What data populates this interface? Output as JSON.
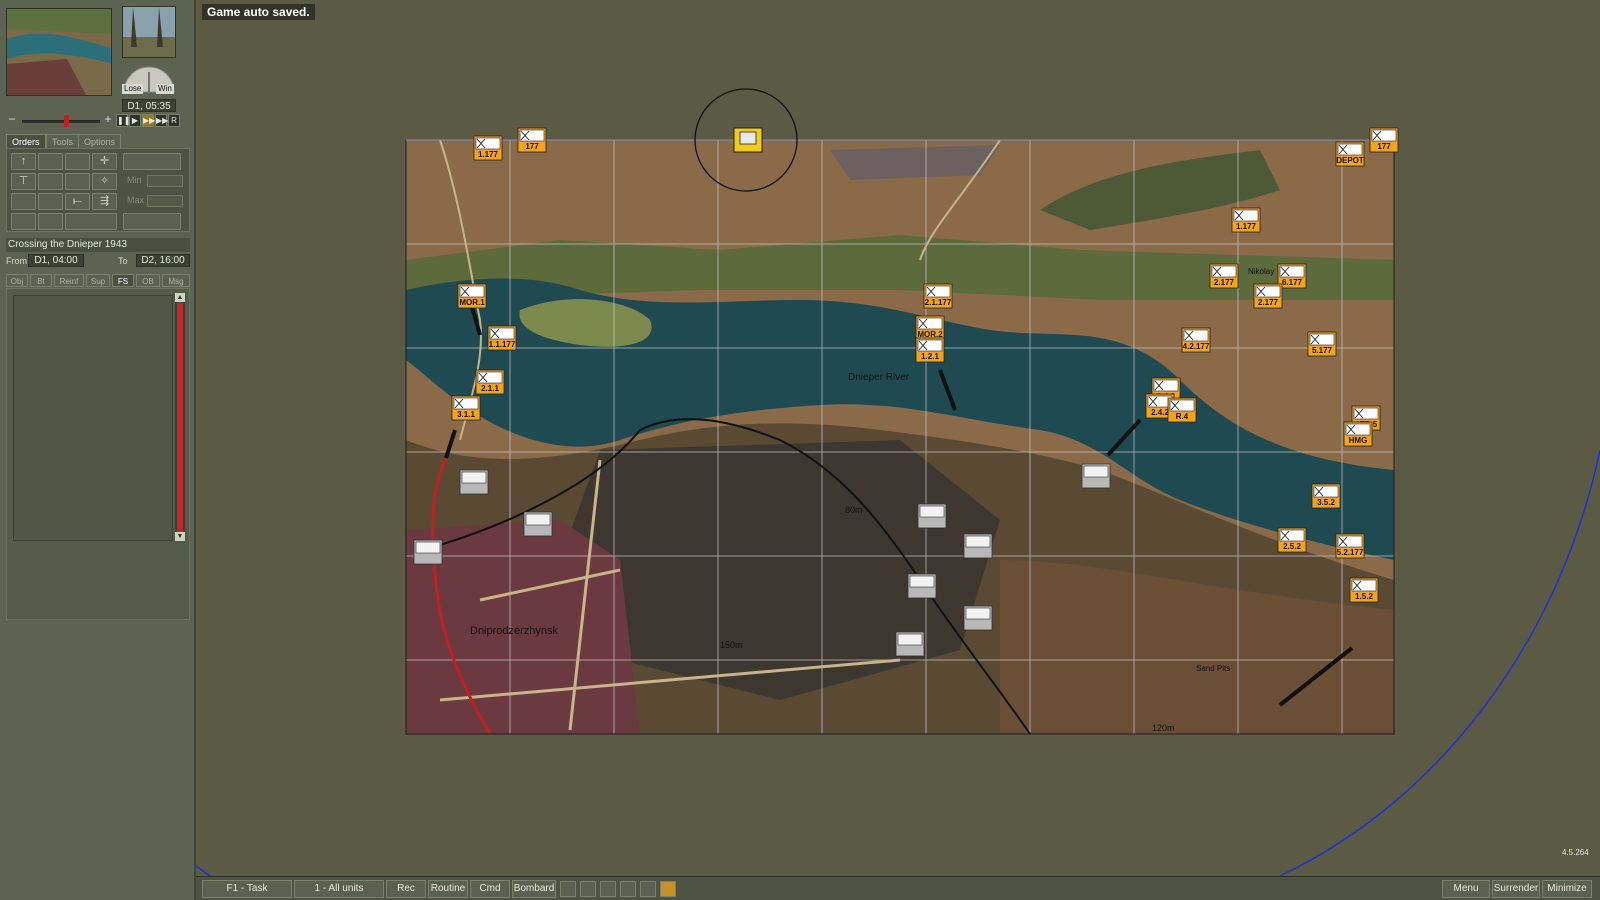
{
  "status_message": "Game auto saved.",
  "version": "4.5.264",
  "sidebar": {
    "gauge": {
      "lose_label": "Lose",
      "win_label": "Win"
    },
    "clock": "D1, 05:35",
    "speed_buttons": [
      "pause",
      "play",
      "fast",
      "fastest",
      "R"
    ],
    "tabs": [
      "Orders",
      "Tools",
      "Options"
    ],
    "min_label": "Min",
    "max_label": "Max",
    "scenario_title": "Crossing the Dnieper 1943",
    "from_label": "From",
    "from_value": "D1, 04:00",
    "to_label": "To",
    "to_value": "D2, 16:00",
    "info_tabs": [
      "Obj",
      "Bt",
      "Reinf",
      "Sup",
      "FS",
      "OB",
      "Msg"
    ]
  },
  "map": {
    "labels": {
      "river": "Dnieper River",
      "town": "Dniprodzerzhynsk",
      "village": "Nikolay",
      "sand_pits": "Sand Pits",
      "elev_80": "80m",
      "elev_150": "150m",
      "elev_120": "120m"
    },
    "units_soviet": [
      {
        "id": "u1",
        "label": "1.177"
      },
      {
        "id": "u2",
        "label": "177"
      },
      {
        "id": "u3",
        "label": "177"
      },
      {
        "id": "u4",
        "label": "DEPOT"
      },
      {
        "id": "u5",
        "label": "1.177"
      },
      {
        "id": "u6",
        "label": "2.177"
      },
      {
        "id": "u7",
        "label": "6.177"
      },
      {
        "id": "u8",
        "label": "2.177"
      },
      {
        "id": "u9",
        "label": "MOR.1"
      },
      {
        "id": "u10",
        "label": "1.1.177"
      },
      {
        "id": "u11",
        "label": "2.1.177"
      },
      {
        "id": "u12",
        "label": "MOR.2"
      },
      {
        "id": "u13",
        "label": "1.2.1"
      },
      {
        "id": "u14",
        "label": "4.2.177"
      },
      {
        "id": "u15",
        "label": "5.177"
      },
      {
        "id": "u16",
        "label": "2.1.1"
      },
      {
        "id": "u17",
        "label": "3.1.1"
      },
      {
        "id": "u18",
        "label": "3.4.2"
      },
      {
        "id": "u19",
        "label": "2.4.2"
      },
      {
        "id": "u20",
        "label": "R.4"
      },
      {
        "id": "u21",
        "label": "ATR.5"
      },
      {
        "id": "u22",
        "label": "HMG"
      },
      {
        "id": "u23",
        "label": "3.5.2"
      },
      {
        "id": "u24",
        "label": "2.5.2"
      },
      {
        "id": "u25",
        "label": "5.2.177"
      },
      {
        "id": "u26",
        "label": "1.5.2"
      }
    ],
    "units_german_count": 10
  },
  "bottom_bar": {
    "buttons": [
      "F1 - Task",
      "1 - All units",
      "Rec",
      "Routine",
      "Cmd",
      "Bombard"
    ],
    "right_buttons": [
      "Menu",
      "Surrender",
      "Minimize"
    ]
  }
}
